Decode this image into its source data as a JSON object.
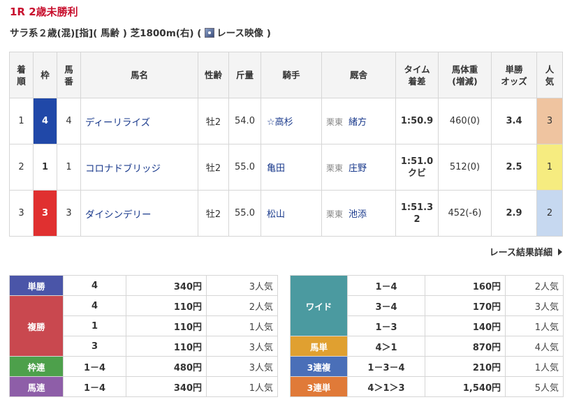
{
  "race": {
    "title": "1R 2歳未勝利",
    "info_text": "サラ系２歳(混)[指]( 馬齢 ) 芝1800m(右)  (",
    "video_label": "レース映像",
    "info_close": ")"
  },
  "result_table": {
    "headers": [
      [
        "着",
        "順"
      ],
      [
        "枠",
        ""
      ],
      [
        "馬",
        "番"
      ],
      [
        "馬名",
        ""
      ],
      [
        "性齢",
        ""
      ],
      [
        "斤量",
        ""
      ],
      [
        "騎手",
        ""
      ],
      [
        "厩舎",
        ""
      ],
      [
        "タイム",
        "着差"
      ],
      [
        "馬体重",
        "(増減)"
      ],
      [
        "単勝",
        "オッズ"
      ],
      [
        "人",
        "気"
      ]
    ],
    "rows": [
      {
        "rank": "1",
        "waku": "4",
        "umaban": "4",
        "name": "ディーリライズ",
        "sexage": "牡2",
        "weight": "54.0",
        "jockey": "☆高杉",
        "area": "栗東",
        "trainer": "緒方",
        "time": "1:50.9",
        "margin": "",
        "body": "460(0)",
        "odds": "3.4",
        "pop": "3"
      },
      {
        "rank": "2",
        "waku": "1",
        "umaban": "1",
        "name": "コロナドブリッジ",
        "sexage": "牡2",
        "weight": "55.0",
        "jockey": "亀田",
        "area": "栗東",
        "trainer": "庄野",
        "time": "1:51.0",
        "margin": "クビ",
        "body": "512(0)",
        "odds": "2.5",
        "pop": "1"
      },
      {
        "rank": "3",
        "waku": "3",
        "umaban": "3",
        "name": "ダイシンデリー",
        "sexage": "牡2",
        "weight": "55.0",
        "jockey": "松山",
        "area": "栗東",
        "trainer": "池添",
        "time": "1:51.3",
        "margin": "2",
        "body": "452(-6)",
        "odds": "2.9",
        "pop": "2"
      }
    ]
  },
  "detail_link": "レース結果詳細",
  "payout_left": [
    {
      "bet": "単勝",
      "color": "#4a55a8",
      "rows": [
        {
          "combo": "4",
          "amount": "340円",
          "pop": "3人気"
        }
      ]
    },
    {
      "bet": "複勝",
      "color": "#c9484f",
      "rows": [
        {
          "combo": "4",
          "amount": "110円",
          "pop": "2人気"
        },
        {
          "combo": "1",
          "amount": "110円",
          "pop": "1人気"
        },
        {
          "combo": "3",
          "amount": "110円",
          "pop": "3人気"
        }
      ]
    },
    {
      "bet": "枠連",
      "color": "#4da04b",
      "rows": [
        {
          "combo": "1－4",
          "amount": "480円",
          "pop": "3人気"
        }
      ]
    },
    {
      "bet": "馬連",
      "color": "#8e5ea8",
      "rows": [
        {
          "combo": "1－4",
          "amount": "340円",
          "pop": "1人気"
        }
      ]
    }
  ],
  "payout_right": [
    {
      "bet": "ワイド",
      "color": "#4b9aa0",
      "rows": [
        {
          "combo": "1－4",
          "amount": "160円",
          "pop": "2人気"
        },
        {
          "combo": "3－4",
          "amount": "170円",
          "pop": "3人気"
        },
        {
          "combo": "1－3",
          "amount": "140円",
          "pop": "1人気"
        }
      ]
    },
    {
      "bet": "馬単",
      "color": "#e0a030",
      "rows": [
        {
          "combo": "4＞1",
          "amount": "870円",
          "pop": "4人気"
        }
      ]
    },
    {
      "bet": "3連複",
      "color": "#4a6fb8",
      "rows": [
        {
          "combo": "1－3－4",
          "amount": "210円",
          "pop": "1人気"
        }
      ]
    },
    {
      "bet": "3連単",
      "color": "#e07a38",
      "rows": [
        {
          "combo": "4＞1＞3",
          "amount": "1,540円",
          "pop": "5人気"
        }
      ]
    }
  ],
  "colors": {
    "title_red": "#c8102e",
    "link_blue": "#1a3a8c",
    "waku": {
      "1": "#ffffff",
      "3": "#e03030",
      "4": "#2048a8"
    },
    "pop": {
      "1": "#f6ec80",
      "2": "#c6d8f0",
      "3": "#efc4a0"
    }
  }
}
